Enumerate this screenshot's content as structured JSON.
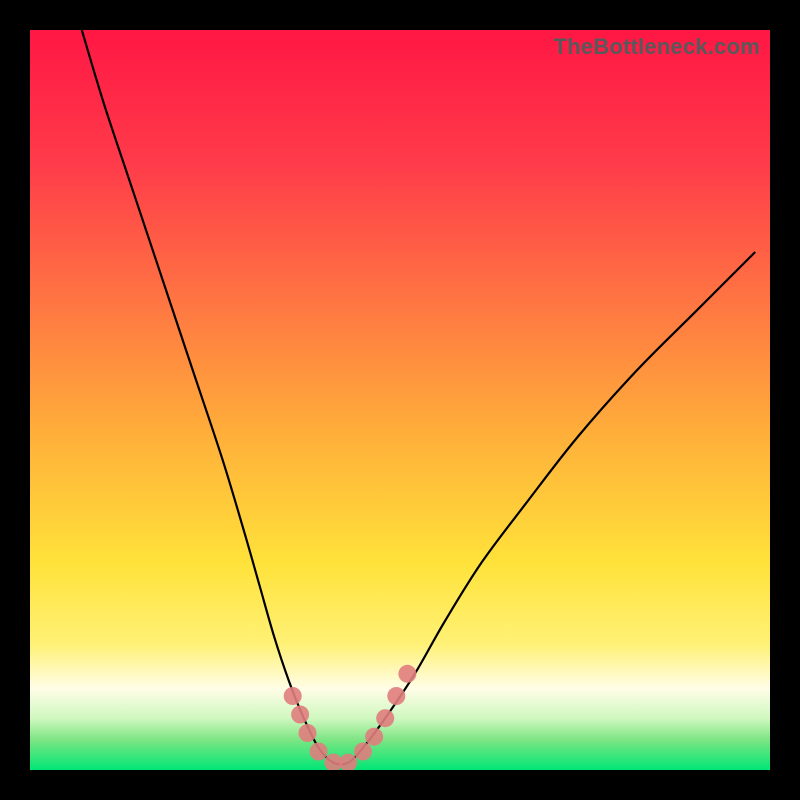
{
  "watermark": "TheBottleneck.com",
  "colors": {
    "black": "#000000",
    "curve": "#000000",
    "dot": "#e07d7d",
    "green_bottom": "#00e676"
  },
  "gradient_stops": [
    {
      "offset": 0.0,
      "color": "#ff1744"
    },
    {
      "offset": 0.18,
      "color": "#ff3b4a"
    },
    {
      "offset": 0.35,
      "color": "#ff7043"
    },
    {
      "offset": 0.55,
      "color": "#ffb03a"
    },
    {
      "offset": 0.72,
      "color": "#ffe23a"
    },
    {
      "offset": 0.83,
      "color": "#fff176"
    },
    {
      "offset": 0.89,
      "color": "#fffde7"
    },
    {
      "offset": 0.93,
      "color": "#d0f8c0"
    },
    {
      "offset": 0.96,
      "color": "#7ae582"
    },
    {
      "offset": 1.0,
      "color": "#00e676"
    }
  ],
  "chart_data": {
    "type": "line",
    "title": "",
    "xlabel": "",
    "ylabel": "",
    "ylim": [
      0,
      100
    ],
    "xlim": [
      0,
      100
    ],
    "series": [
      {
        "name": "bottleneck-curve",
        "x": [
          7,
          10,
          14,
          18,
          22,
          26,
          29,
          31,
          33,
          35,
          37,
          39,
          41,
          43,
          45,
          48,
          52,
          56,
          61,
          67,
          74,
          82,
          90,
          98
        ],
        "values": [
          100,
          90,
          78,
          66,
          54,
          42,
          32,
          25,
          18,
          12,
          7,
          3,
          1,
          1,
          3,
          7,
          13,
          20,
          28,
          36,
          45,
          54,
          62,
          70
        ]
      }
    ],
    "dots": {
      "name": "highlight-points",
      "x": [
        35.5,
        36.5,
        37.5,
        39,
        41,
        43,
        45,
        46.5,
        48,
        49.5,
        51
      ],
      "values": [
        10,
        7.5,
        5,
        2.5,
        1,
        1,
        2.5,
        4.5,
        7,
        10,
        13
      ]
    }
  }
}
